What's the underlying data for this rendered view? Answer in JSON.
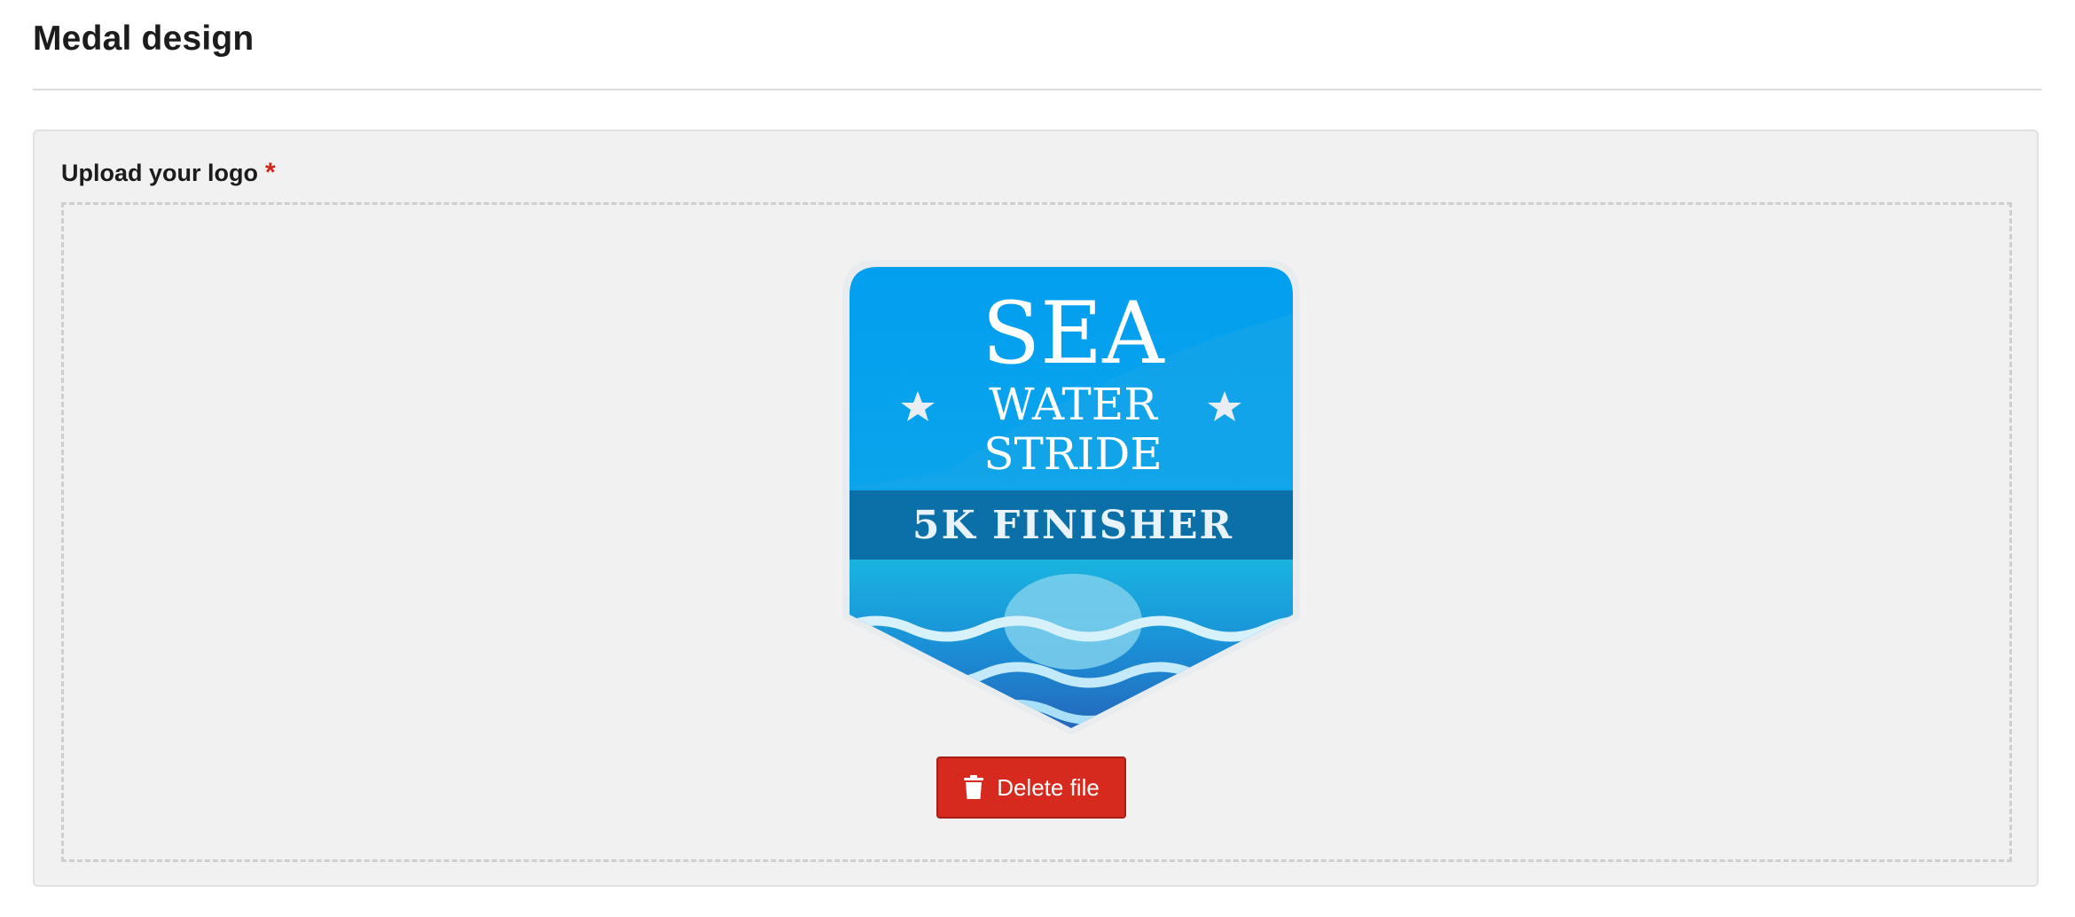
{
  "section": {
    "title": "Medal design"
  },
  "upload": {
    "label": "Upload your logo",
    "required_marker": "*"
  },
  "medal": {
    "line1": "SEA",
    "line2": "WATER",
    "line3": "STRIDE",
    "banner": "5K FINISHER"
  },
  "actions": {
    "delete_label": "Delete file",
    "delete_icon": "trash-icon"
  },
  "colors": {
    "delete_button": "#d62a1e",
    "required_marker": "#d0261b",
    "medal_sky": "#03a3ec",
    "medal_banner": "#0b6fa8"
  }
}
